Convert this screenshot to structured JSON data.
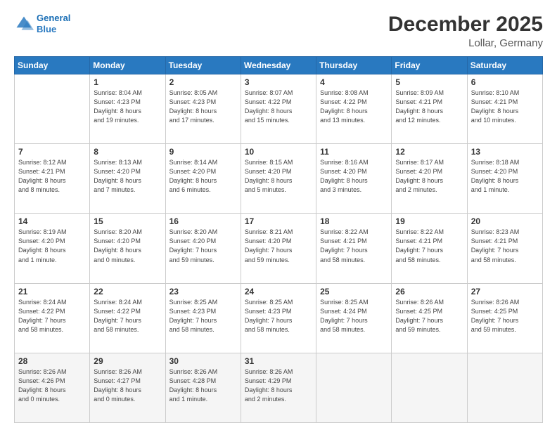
{
  "header": {
    "logo_line1": "General",
    "logo_line2": "Blue",
    "title": "December 2025",
    "location": "Lollar, Germany"
  },
  "calendar": {
    "days_of_week": [
      "Sunday",
      "Monday",
      "Tuesday",
      "Wednesday",
      "Thursday",
      "Friday",
      "Saturday"
    ],
    "weeks": [
      [
        {
          "day": "",
          "info": ""
        },
        {
          "day": "1",
          "info": "Sunrise: 8:04 AM\nSunset: 4:23 PM\nDaylight: 8 hours\nand 19 minutes."
        },
        {
          "day": "2",
          "info": "Sunrise: 8:05 AM\nSunset: 4:23 PM\nDaylight: 8 hours\nand 17 minutes."
        },
        {
          "day": "3",
          "info": "Sunrise: 8:07 AM\nSunset: 4:22 PM\nDaylight: 8 hours\nand 15 minutes."
        },
        {
          "day": "4",
          "info": "Sunrise: 8:08 AM\nSunset: 4:22 PM\nDaylight: 8 hours\nand 13 minutes."
        },
        {
          "day": "5",
          "info": "Sunrise: 8:09 AM\nSunset: 4:21 PM\nDaylight: 8 hours\nand 12 minutes."
        },
        {
          "day": "6",
          "info": "Sunrise: 8:10 AM\nSunset: 4:21 PM\nDaylight: 8 hours\nand 10 minutes."
        }
      ],
      [
        {
          "day": "7",
          "info": "Sunrise: 8:12 AM\nSunset: 4:21 PM\nDaylight: 8 hours\nand 8 minutes."
        },
        {
          "day": "8",
          "info": "Sunrise: 8:13 AM\nSunset: 4:20 PM\nDaylight: 8 hours\nand 7 minutes."
        },
        {
          "day": "9",
          "info": "Sunrise: 8:14 AM\nSunset: 4:20 PM\nDaylight: 8 hours\nand 6 minutes."
        },
        {
          "day": "10",
          "info": "Sunrise: 8:15 AM\nSunset: 4:20 PM\nDaylight: 8 hours\nand 5 minutes."
        },
        {
          "day": "11",
          "info": "Sunrise: 8:16 AM\nSunset: 4:20 PM\nDaylight: 8 hours\nand 3 minutes."
        },
        {
          "day": "12",
          "info": "Sunrise: 8:17 AM\nSunset: 4:20 PM\nDaylight: 8 hours\nand 2 minutes."
        },
        {
          "day": "13",
          "info": "Sunrise: 8:18 AM\nSunset: 4:20 PM\nDaylight: 8 hours\nand 1 minute."
        }
      ],
      [
        {
          "day": "14",
          "info": "Sunrise: 8:19 AM\nSunset: 4:20 PM\nDaylight: 8 hours\nand 1 minute."
        },
        {
          "day": "15",
          "info": "Sunrise: 8:20 AM\nSunset: 4:20 PM\nDaylight: 8 hours\nand 0 minutes."
        },
        {
          "day": "16",
          "info": "Sunrise: 8:20 AM\nSunset: 4:20 PM\nDaylight: 7 hours\nand 59 minutes."
        },
        {
          "day": "17",
          "info": "Sunrise: 8:21 AM\nSunset: 4:20 PM\nDaylight: 7 hours\nand 59 minutes."
        },
        {
          "day": "18",
          "info": "Sunrise: 8:22 AM\nSunset: 4:21 PM\nDaylight: 7 hours\nand 58 minutes."
        },
        {
          "day": "19",
          "info": "Sunrise: 8:22 AM\nSunset: 4:21 PM\nDaylight: 7 hours\nand 58 minutes."
        },
        {
          "day": "20",
          "info": "Sunrise: 8:23 AM\nSunset: 4:21 PM\nDaylight: 7 hours\nand 58 minutes."
        }
      ],
      [
        {
          "day": "21",
          "info": "Sunrise: 8:24 AM\nSunset: 4:22 PM\nDaylight: 7 hours\nand 58 minutes."
        },
        {
          "day": "22",
          "info": "Sunrise: 8:24 AM\nSunset: 4:22 PM\nDaylight: 7 hours\nand 58 minutes."
        },
        {
          "day": "23",
          "info": "Sunrise: 8:25 AM\nSunset: 4:23 PM\nDaylight: 7 hours\nand 58 minutes."
        },
        {
          "day": "24",
          "info": "Sunrise: 8:25 AM\nSunset: 4:23 PM\nDaylight: 7 hours\nand 58 minutes."
        },
        {
          "day": "25",
          "info": "Sunrise: 8:25 AM\nSunset: 4:24 PM\nDaylight: 7 hours\nand 58 minutes."
        },
        {
          "day": "26",
          "info": "Sunrise: 8:26 AM\nSunset: 4:25 PM\nDaylight: 7 hours\nand 59 minutes."
        },
        {
          "day": "27",
          "info": "Sunrise: 8:26 AM\nSunset: 4:25 PM\nDaylight: 7 hours\nand 59 minutes."
        }
      ],
      [
        {
          "day": "28",
          "info": "Sunrise: 8:26 AM\nSunset: 4:26 PM\nDaylight: 8 hours\nand 0 minutes."
        },
        {
          "day": "29",
          "info": "Sunrise: 8:26 AM\nSunset: 4:27 PM\nDaylight: 8 hours\nand 0 minutes."
        },
        {
          "day": "30",
          "info": "Sunrise: 8:26 AM\nSunset: 4:28 PM\nDaylight: 8 hours\nand 1 minute."
        },
        {
          "day": "31",
          "info": "Sunrise: 8:26 AM\nSunset: 4:29 PM\nDaylight: 8 hours\nand 2 minutes."
        },
        {
          "day": "",
          "info": ""
        },
        {
          "day": "",
          "info": ""
        },
        {
          "day": "",
          "info": ""
        }
      ]
    ]
  }
}
